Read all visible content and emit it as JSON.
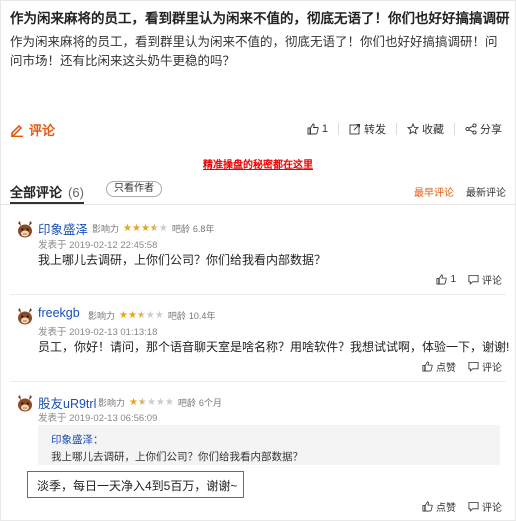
{
  "post": {
    "title": "作为闲来麻将的员工，看到群里认为闲来不值的，彻底无语了！你们也好好搞搞调研！问问",
    "body": "作为闲来麻将的员工，看到群里认为闲来不值的，彻底无语了！你们也好好搞搞调研！问问市场！还有比闲来这头奶牛更稳的吗？"
  },
  "toolbar": {
    "comment_label": "评论",
    "like_count": "1",
    "forward_label": "转发",
    "favorite_label": "收藏",
    "share_label": "分享"
  },
  "promo_link": "精准操盘的秘密都在这里",
  "tabs": {
    "all_label": "全部评论",
    "all_count": "(6)",
    "author_only": "只看作者",
    "sort_hot": "最早评论",
    "sort_new": "最新评论"
  },
  "labels": {
    "influence": "影响力",
    "bar_age": "吧龄"
  },
  "comments": [
    {
      "user": "印象盛泽",
      "stars": 3.5,
      "bar_age": "6.8年",
      "time": "发表于 2019-02-12 22:45:58",
      "text": "我上哪儿去调研，上你们公司？你们给我看内部数据？",
      "like": "1",
      "reply": "评论"
    },
    {
      "user": "freekgb",
      "stars": 2.5,
      "bar_age": "10.4年",
      "time": "发表于 2019-02-13 01:13:18",
      "text": "员工，你好！请问，那个语音聊天室是啥名称？用啥软件？我想试试啊，体验一下，谢谢!",
      "like": "点赞",
      "reply": "评论"
    },
    {
      "user": "股友uR9trl",
      "stars": 1.5,
      "bar_age": "6个月",
      "time": "发表于 2019-02-13 06:56:09",
      "quote_user": "印象盛泽：",
      "quote_text": "我上哪儿去调研，上你们公司？你们给我看内部数据？",
      "text": "淡季，每日一天净入4到5百万，谢谢~",
      "like": "点赞",
      "reply": "评论"
    }
  ],
  "colors": {
    "accent": "#e8590c",
    "link": "#1a4fb5",
    "promo": "#ee0000",
    "star": "#e8a317"
  }
}
